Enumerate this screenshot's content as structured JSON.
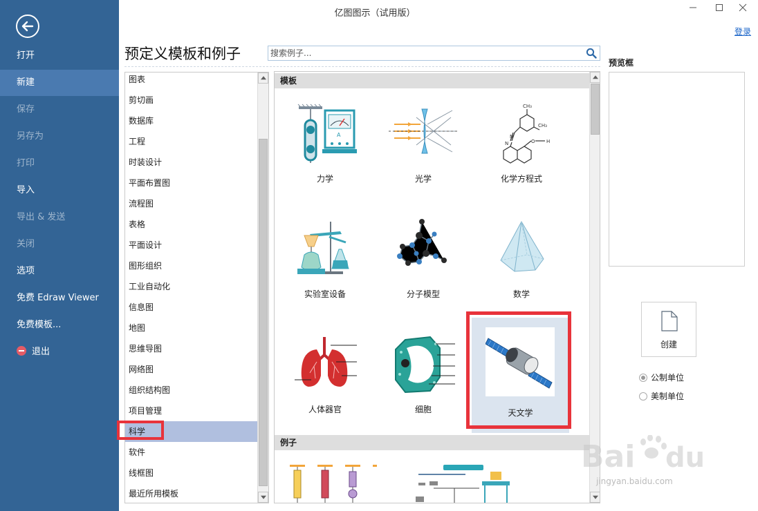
{
  "window": {
    "title": "亿图图示（试用版）",
    "login_label": "登录"
  },
  "nav": {
    "items": [
      {
        "label": "打开",
        "state": "enabled"
      },
      {
        "label": "新建",
        "state": "active"
      },
      {
        "label": "保存",
        "state": "disabled"
      },
      {
        "label": "另存为",
        "state": "disabled"
      },
      {
        "label": "打印",
        "state": "disabled"
      },
      {
        "label": "导入",
        "state": "enabled"
      },
      {
        "label": "导出 & 发送",
        "state": "disabled"
      },
      {
        "label": "关闭",
        "state": "disabled"
      },
      {
        "label": "选项",
        "state": "enabled"
      },
      {
        "label": "免费 Edraw Viewer",
        "state": "enabled"
      },
      {
        "label": "免费模板...",
        "state": "enabled"
      },
      {
        "label": "退出",
        "state": "enabled"
      }
    ]
  },
  "main": {
    "heading": "预定义模板和例子",
    "search": {
      "placeholder": "搜索例子..."
    }
  },
  "categories": {
    "selected": "科学",
    "items": [
      "图表",
      "剪切画",
      "数据库",
      "工程",
      "时装设计",
      "平面布置图",
      "流程图",
      "表格",
      "平面设计",
      "图形组织",
      "工业自动化",
      "信息图",
      "地图",
      "思维导图",
      "网络图",
      "组织结构图",
      "项目管理",
      "科学",
      "软件",
      "线框图",
      "最近所用模板"
    ]
  },
  "gallery": {
    "templates_header": "模板",
    "examples_header": "例子",
    "selected": "天文学",
    "templates": [
      "力学",
      "光学",
      "化学方程式",
      "实验室设备",
      "分子模型",
      "数学",
      "人体器官",
      "细胞",
      "天文学"
    ]
  },
  "preview": {
    "label": "预览框",
    "create_label": "创建",
    "unit_options": [
      {
        "label": "公制单位",
        "selected": true
      },
      {
        "label": "美制单位",
        "selected": false
      }
    ]
  },
  "colors": {
    "nav_bg": "#336495",
    "nav_active": "#4a7ab0",
    "highlight_red": "#e8333b",
    "selected_category": "#b0bfdf",
    "link": "#1a64c8"
  },
  "watermark": {
    "url": "jingyan.baidu.com"
  }
}
